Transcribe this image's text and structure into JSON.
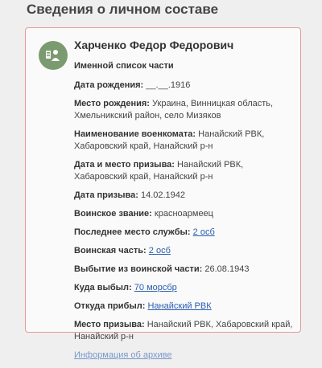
{
  "section_title": "Сведения о личном составе",
  "card": {
    "name": "Харченко Федор Федорович",
    "subtitle": "Именной список части",
    "fields": [
      {
        "label": "Дата рождения:",
        "value": "__.__.1916"
      },
      {
        "label": "Место рождения:",
        "value": "Украина, Винницкая область, Хмельникский район, село Мизяков"
      },
      {
        "label": "Наименование военкомата:",
        "value": "Нанайский РВК, Хабаровский край, Нанайский р-н"
      },
      {
        "label": "Дата и место призыва:",
        "value": "Нанайский РВК, Хабаровский край, Нанайский р-н"
      },
      {
        "label": "Дата призыва:",
        "value": "14.02.1942"
      },
      {
        "label": "Воинское звание:",
        "value": "красноармеец"
      },
      {
        "label": "Последнее место службы:",
        "link": "2 осб"
      },
      {
        "label": "Воинская часть:",
        "link": "2 осб"
      },
      {
        "label": "Выбытие из воинской части:",
        "value": "26.08.1943"
      },
      {
        "label": "Куда выбыл:",
        "link": "70 морсбр"
      },
      {
        "label": "Откуда прибыл:",
        "link": "Нанайский РВК"
      },
      {
        "label": "Место призыва:",
        "value": "Нанайский РВК, Хабаровский край, Нанайский р-н"
      }
    ],
    "more_link": "Информация об архиве"
  }
}
